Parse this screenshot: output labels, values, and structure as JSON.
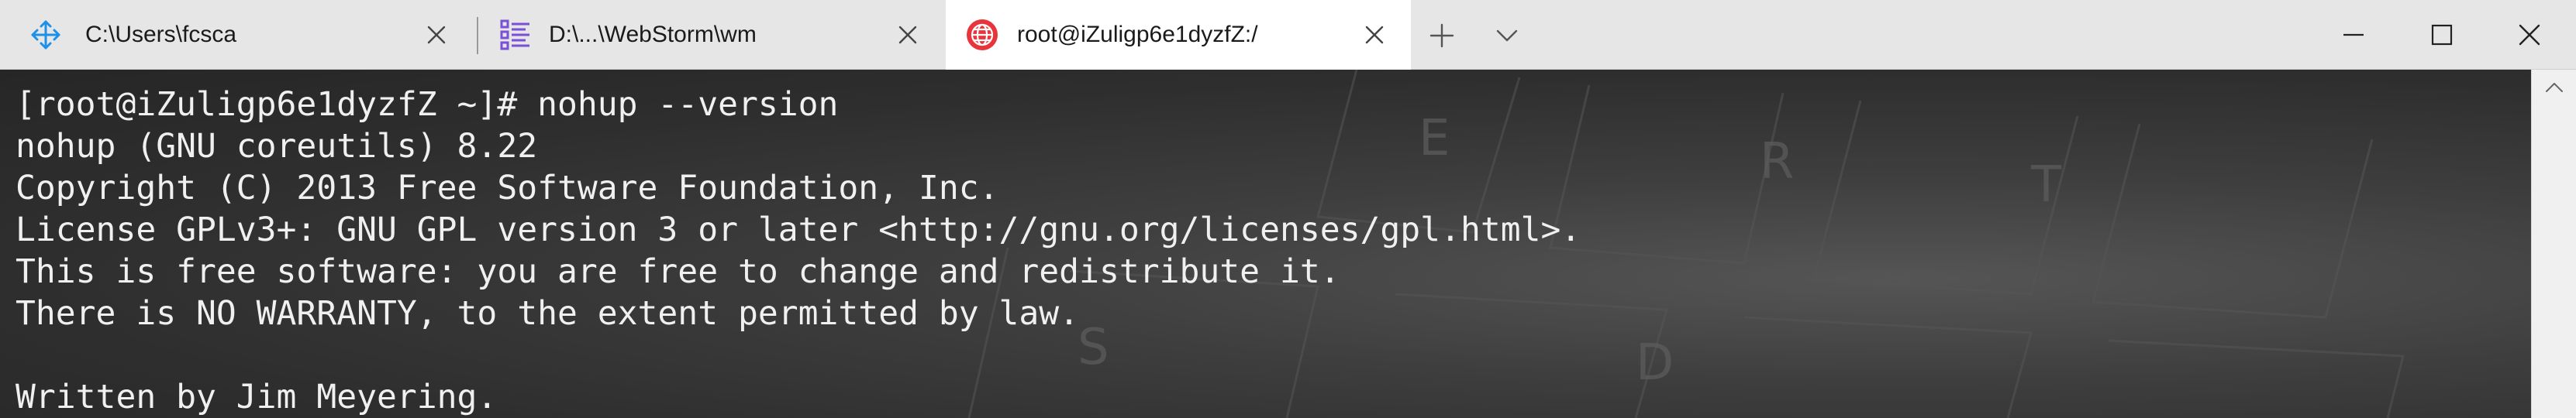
{
  "tabs": [
    {
      "title": "C:\\Users\\fcsca",
      "icon": "arrows-move-icon",
      "active": false
    },
    {
      "title": "D:\\...\\WebStorm\\wm",
      "icon": "checklist-icon",
      "active": false
    },
    {
      "title": "root@iZuligp6e1dyzfZ:/",
      "icon": "globe-icon",
      "active": true
    }
  ],
  "colors": {
    "tabbar_bg": "#e6e6e6",
    "active_tab_bg": "#ffffff",
    "terminal_text": "#f0f0f0",
    "globe_icon": "#e8343b",
    "move_icon": "#1e90e8",
    "checklist_icon": "#7b4fd6"
  },
  "terminal": {
    "lines": [
      "[root@iZuligp6e1dyzfZ ~]# nohup --version",
      "nohup (GNU coreutils) 8.22",
      "Copyright (C) 2013 Free Software Foundation, Inc.",
      "License GPLv3+: GNU GPL version 3 or later <http://gnu.org/licenses/gpl.html>.",
      "This is free software: you are free to change and redistribute it.",
      "There is NO WARRANTY, to the extent permitted by law.",
      "",
      "Written by Jim Meyering."
    ]
  }
}
